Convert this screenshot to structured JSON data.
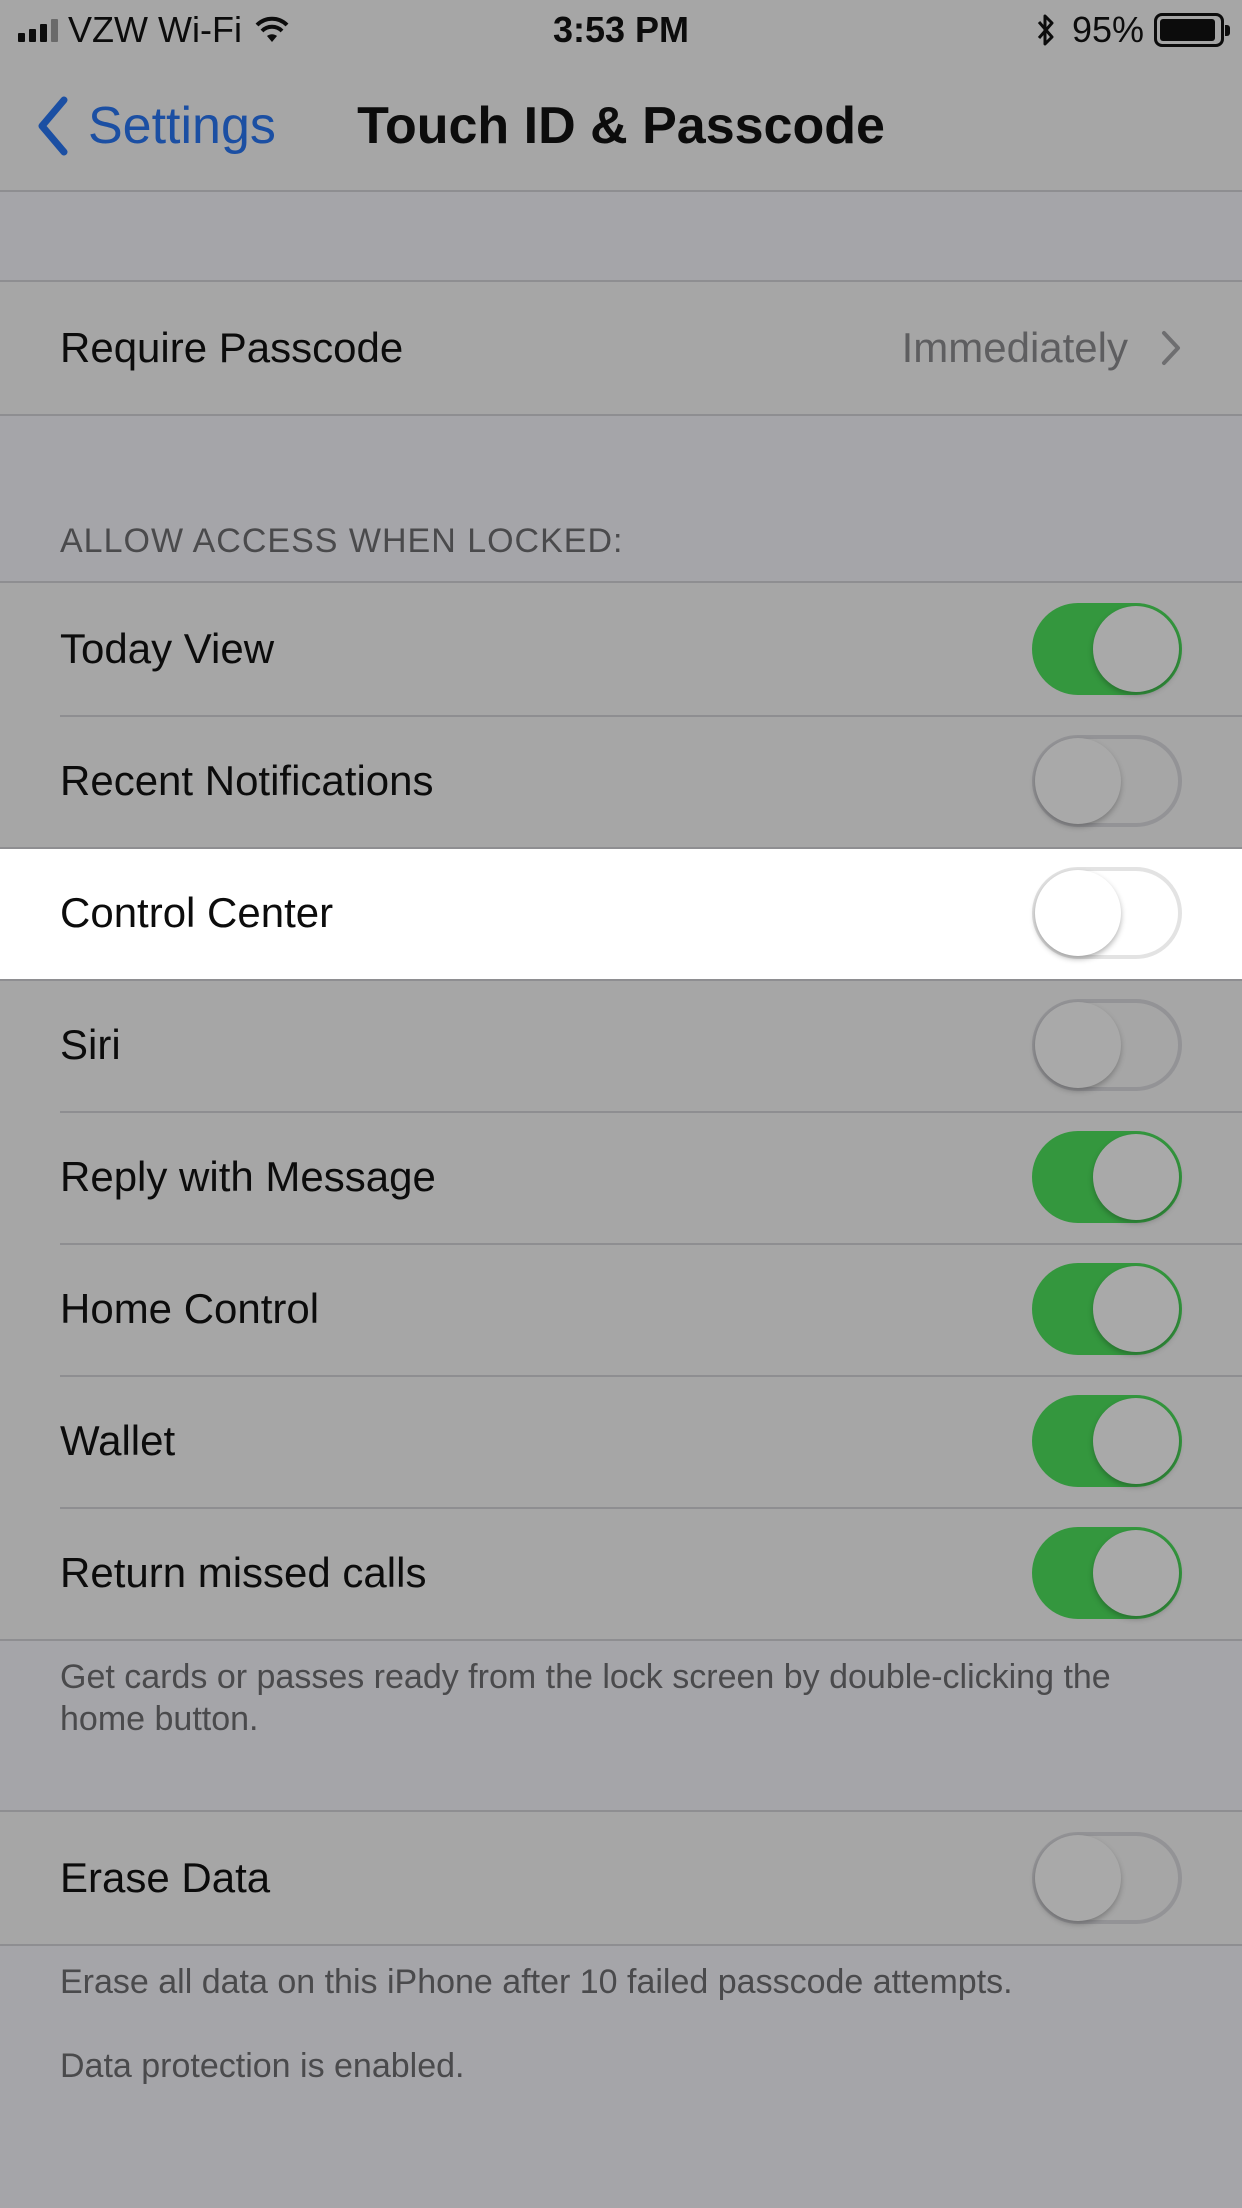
{
  "status_bar": {
    "carrier": "VZW Wi-Fi",
    "time": "3:53 PM",
    "battery_percent": "95%"
  },
  "nav": {
    "back_label": "Settings",
    "title": "Touch ID & Passcode"
  },
  "require_passcode": {
    "label": "Require Passcode",
    "value": "Immediately"
  },
  "access_section": {
    "header": "ALLOW ACCESS WHEN LOCKED:",
    "items": [
      {
        "label": "Today View",
        "on": true
      },
      {
        "label": "Recent Notifications",
        "on": false
      },
      {
        "label": "Control Center",
        "on": false
      },
      {
        "label": "Siri",
        "on": false
      },
      {
        "label": "Reply with Message",
        "on": true
      },
      {
        "label": "Home Control",
        "on": true
      },
      {
        "label": "Wallet",
        "on": true
      },
      {
        "label": "Return missed calls",
        "on": true
      }
    ],
    "footer": "Get cards or passes ready from the lock screen by double-clicking the home button."
  },
  "erase_data": {
    "label": "Erase Data",
    "on": false,
    "footer_1": "Erase all data on this iPhone after 10 failed passcode attempts.",
    "footer_2": "Data protection is enabled."
  },
  "colors": {
    "toggle_on": "#34973e",
    "link_blue": "#1b4fa3",
    "dimmed_background": "#a5a5a9",
    "highlight_row": "#ffffff"
  },
  "icons": [
    "cellular-signal-icon",
    "wifi-icon",
    "bluetooth-icon",
    "battery-icon",
    "back-chevron-icon",
    "disclosure-chevron-icon"
  ]
}
